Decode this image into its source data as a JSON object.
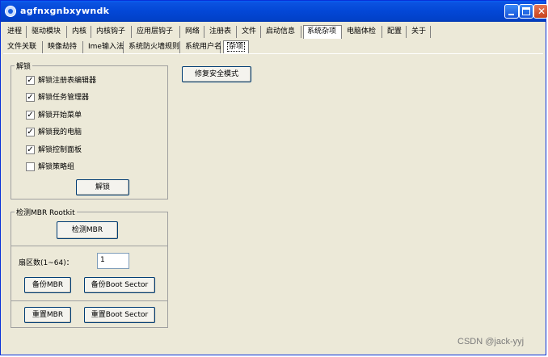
{
  "window": {
    "title": "agfnxgnbxywndk"
  },
  "main_tabs": [
    "进程",
    "驱动模块",
    "内核",
    "内核钩子",
    "应用层钩子",
    "网络",
    "注册表",
    "文件",
    "启动信息",
    "系统杂项",
    "电脑体检",
    "配置",
    "关于"
  ],
  "main_tab_active": "系统杂项",
  "sub_tabs": [
    "文件关联",
    "映像劫持",
    "Ime输入法",
    "系统防火墙规则",
    "系统用户名",
    "杂项"
  ],
  "sub_tab_active": "杂项",
  "unlock_group": {
    "title": "解锁",
    "checkboxes": [
      {
        "label": "解锁注册表编辑器",
        "checked": true
      },
      {
        "label": "解锁任务管理器",
        "checked": true
      },
      {
        "label": "解锁开始菜单",
        "checked": true
      },
      {
        "label": "解锁我的电脑",
        "checked": true
      },
      {
        "label": "解锁控制面板",
        "checked": true
      },
      {
        "label": "解锁策略组",
        "checked": false
      }
    ],
    "button": "解锁"
  },
  "repair_button": "修复安全模式",
  "mbr_group": {
    "title": "检测MBR Rootkit",
    "detect_button": "检测MBR",
    "sector_label": "扇区数(1~64)：",
    "sector_value": "1",
    "backup_mbr": "备份MBR",
    "backup_boot": "备份Boot Sector",
    "reset_mbr": "重置MBR",
    "reset_boot": "重置Boot Sector"
  },
  "watermark": "CSDN @jack-yyj"
}
